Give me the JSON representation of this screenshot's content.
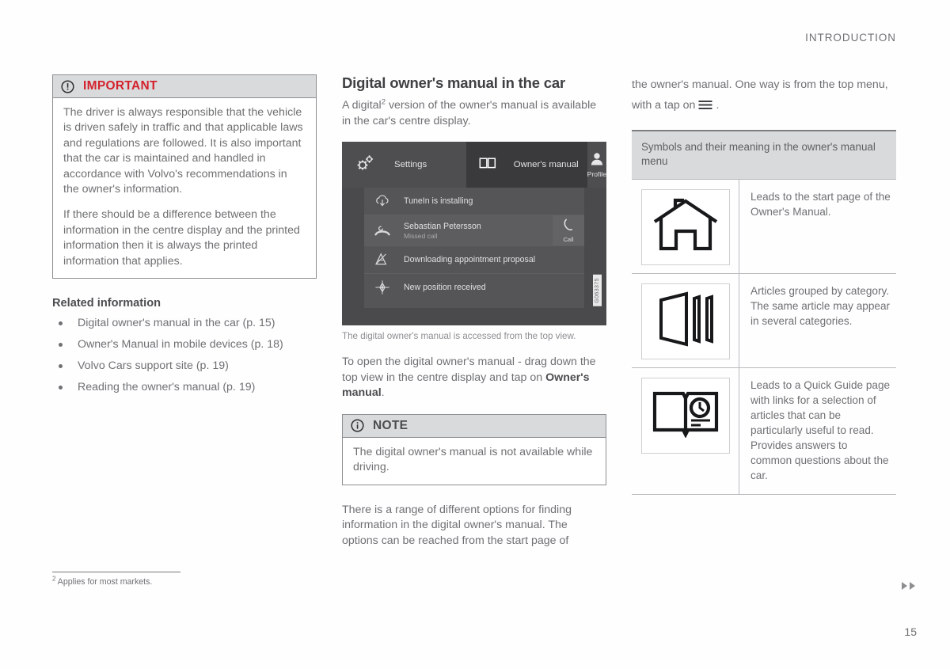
{
  "header": {
    "running_title": "INTRODUCTION"
  },
  "important_box": {
    "icon": "circle-exclamation-icon",
    "title": "IMPORTANT",
    "title_color": "#d4222c",
    "paragraphs": [
      "The driver is always responsible that the vehicle is driven safely in traffic and that applicable laws and regulations are followed. It is also important that the car is maintained and handled in accordance with Volvo's recommendations in the owner's information.",
      "If there should be a difference between the information in the centre display and the printed information then it is always the printed information that applies."
    ]
  },
  "related_information": {
    "heading": "Related information",
    "items": [
      "Digital owner's manual in the car (p. 15)",
      "Owner's Manual in mobile devices (p. 18)",
      "Volvo Cars support site (p. 19)",
      "Reading the owner's manual (p. 19)"
    ]
  },
  "main_section": {
    "title": "Digital owner's manual in the car",
    "intro_before_sup": "A digital",
    "intro_sup": "2",
    "intro_after_sup": " version of the owner's manual is available in the car's centre display.",
    "caption": "The digital owner's manual is accessed from the top view.",
    "instruction_before_bold": "To open the digital owner's manual - drag down the top view in the centre display and tap on ",
    "instruction_bold": "Owner's manual",
    "instruction_after_bold": ".",
    "options_paragraph": "There is a range of different options for finding information in the digital owner's manual. The options can be reached from the start page of"
  },
  "centre_display": {
    "tabs": [
      {
        "icon": "gears-icon",
        "label": "Settings"
      },
      {
        "icon": "open-book-icon",
        "label": "Owner's manual"
      },
      {
        "icon": "profile-person-icon",
        "label": "Profile"
      }
    ],
    "notifications": [
      {
        "icon": "cloud-download-icon",
        "title": "TuneIn is installing",
        "subtitle": ""
      },
      {
        "icon": "missed-call-icon",
        "title": "Sebastian Petersson",
        "subtitle": "Missed call",
        "action_icon": "phone-handset-icon",
        "action_label": "Call"
      },
      {
        "icon": "calendar-download-icon",
        "title": "Downloading appointment proposal",
        "subtitle": ""
      },
      {
        "icon": "compass-position-icon",
        "title": "New position received",
        "subtitle": ""
      }
    ],
    "watermark": "G063375"
  },
  "note_box": {
    "icon": "circle-info-icon",
    "title": "NOTE",
    "paragraphs": [
      "The digital owner's manual is not available while driving."
    ]
  },
  "right_column": {
    "continued_paragraph_part1": "the owner's manual. One way is from the top menu, with a tap on",
    "continued_paragraph_part2": ".",
    "burger_icon": "hamburger-menu-icon"
  },
  "symbols_table": {
    "header": "Symbols and their meaning in the owner's manual menu",
    "rows": [
      {
        "icon": "house-icon",
        "description": "Leads to the start page of the Owner's Manual."
      },
      {
        "icon": "categories-panels-icon",
        "description": "Articles grouped by category. The same article may appear in several categories."
      },
      {
        "icon": "quick-guide-book-clock-icon",
        "description": "Leads to a Quick Guide page with links for a selection of articles that can be particularly useful to read. Provides answers to common questions about the car."
      }
    ]
  },
  "footnote": {
    "marker": "2",
    "text": " Applies for most markets."
  },
  "page_footer": {
    "next_arrows_icon": "double-right-arrow-icon",
    "page_number": "15"
  }
}
